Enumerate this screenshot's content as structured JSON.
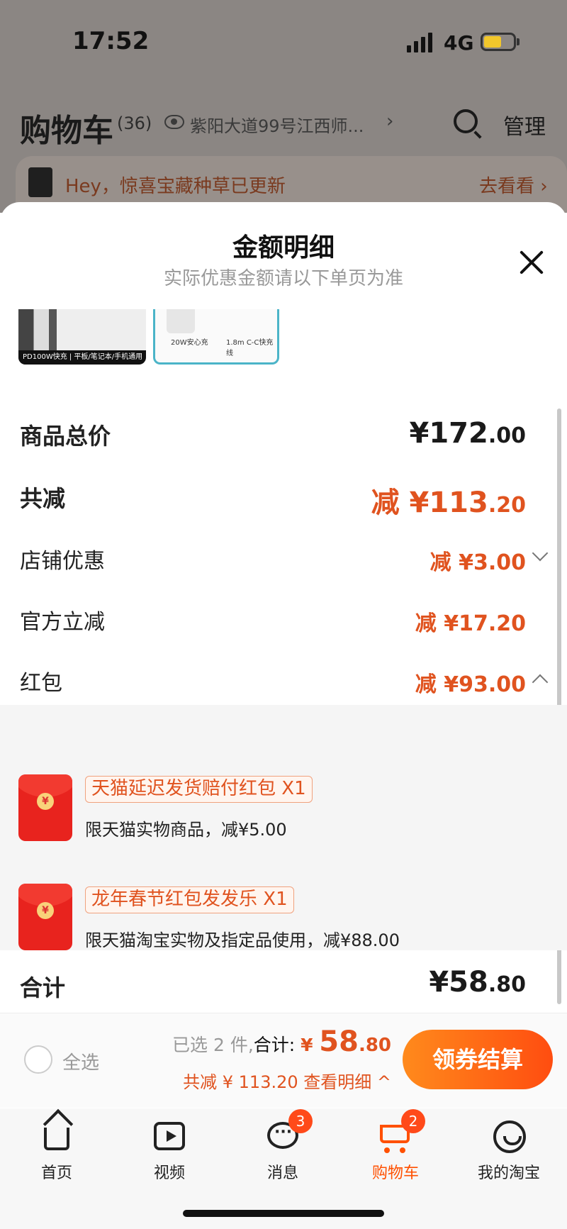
{
  "status": {
    "time": "17:52",
    "network": "4G"
  },
  "cart_header": {
    "title": "购物车",
    "count": "(36)",
    "address": "紫阳大道99号江西师...",
    "manage": "管理"
  },
  "promo_banner": {
    "text": "Hey，惊喜宝藏种草已更新",
    "link": "去看看 ›"
  },
  "sheet": {
    "title": "金额明细",
    "subtitle": "实际优惠金额请以下单页为准",
    "thumb1_caption": "PD100W快充 | 平板/笔记本/手机通用",
    "thumb2_caption_a": "20W安心充",
    "thumb2_caption_b": "1.8m C-C快充线",
    "rows": [
      {
        "label": "商品总价",
        "prefix": "",
        "main": "¥172",
        "decimals": ".00"
      },
      {
        "label": "共减",
        "prefix": "减 ",
        "main": "¥113",
        "decimals": ".20"
      },
      {
        "label": "店铺优惠",
        "prefix": "减 ",
        "main": "¥3",
        "decimals": ".00"
      },
      {
        "label": "官方立减",
        "prefix": "减 ",
        "main": "¥17",
        "decimals": ".20"
      },
      {
        "label": "红包",
        "prefix": "减 ",
        "main": "¥93",
        "decimals": ".00"
      }
    ],
    "red_packets": [
      {
        "tag": "天猫延迟发货赔付红包 X1",
        "desc": "限天猫实物商品，减¥5.00"
      },
      {
        "tag": "龙年春节红包发发乐 X1",
        "desc": "限天猫淘宝实物及指定品使用，减¥88.00"
      }
    ],
    "total": {
      "label": "合计",
      "main": "¥58",
      "decimals": ".80"
    }
  },
  "checkout": {
    "select_all": "全选",
    "selected_text": "已选 2 件,",
    "sum_label": "合计: ",
    "sum_currency": "¥ ",
    "sum_main": "58",
    "sum_decimals": ".80",
    "saved_text": "共减 ¥ 113.20  查看明细 ^",
    "button": "领券结算"
  },
  "tabbar": [
    {
      "label": "首页",
      "icon": "home-icon"
    },
    {
      "label": "视频",
      "icon": "video-icon"
    },
    {
      "label": "消息",
      "icon": "message-icon",
      "badge": "3"
    },
    {
      "label": "购物车",
      "icon": "cart-icon",
      "badge": "2",
      "active": true
    },
    {
      "label": "我的淘宝",
      "icon": "profile-icon"
    }
  ],
  "colors": {
    "accent": "#ff5000",
    "discount": "#e0531f",
    "red_packet": "#e8231e"
  }
}
